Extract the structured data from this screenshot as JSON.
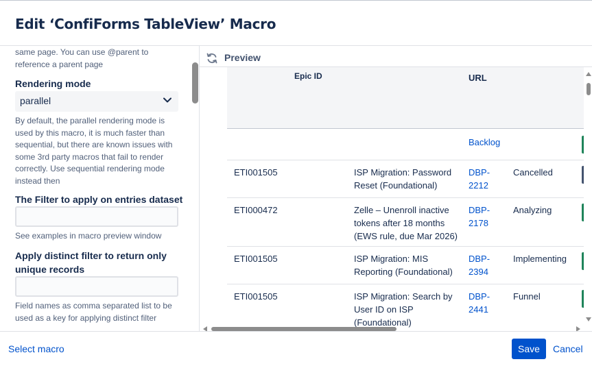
{
  "dialog": {
    "title": "Edit ‘ConfiForms TableView’ Macro"
  },
  "settings": {
    "parent_help": [
      "same page. You can use @parent to",
      "reference a parent page"
    ],
    "rendering_mode": {
      "label": "Rendering mode",
      "value": "parallel",
      "help": [
        "By default, the parallel rendering mode is",
        "used by this macro, it is much faster than",
        "sequential, but there are known issues with",
        "some 3rd party macros that fail to render",
        "correctly. Use sequential rendering mode",
        "instead then"
      ]
    },
    "filter": {
      "label": "The Filter to apply on entries dataset",
      "value": "",
      "help": "See examples in macro preview window"
    },
    "distinct": {
      "label": [
        "Apply distinct filter to return only",
        "unique records"
      ],
      "value": "",
      "help": [
        "Field names as comma separated list to be",
        "used as a key for applying distinct filter"
      ]
    }
  },
  "preview": {
    "label": "Preview",
    "refresh_icon": "refresh-icon",
    "columns": {
      "epic_id": "Epic ID",
      "url": "URL"
    },
    "rows": [
      {
        "id": "",
        "name": [],
        "url": [
          "Backlog"
        ],
        "status": "",
        "bar_color": "#1f845a"
      },
      {
        "id": "ETI001505",
        "name": [
          "ISP Migration: Password",
          "Reset (Foundational)"
        ],
        "url": [
          "DBP-",
          "2212"
        ],
        "status": "Cancelled",
        "bar_color": "#44546f"
      },
      {
        "id": "ETI000472",
        "name": [
          "Zelle – Unenroll inactive",
          "tokens after 18 months",
          "(EWS rule, due Mar 2026)"
        ],
        "url": [
          "DBP-",
          "2178"
        ],
        "status": "Analyzing",
        "bar_color": "#1f845a"
      },
      {
        "id": "ETI001505",
        "name": [
          "ISP Migration: MIS",
          "Reporting (Foundational)"
        ],
        "url": [
          "DBP-",
          "2394"
        ],
        "status": "Implementing",
        "bar_color": "#1f845a"
      },
      {
        "id": "ETI001505",
        "name": [
          "ISP Migration: Search by",
          "User ID on ISP",
          "(Foundational)"
        ],
        "url": [
          "DBP-",
          "2441"
        ],
        "status": "Funnel",
        "bar_color": "#1f845a"
      }
    ]
  },
  "footer": {
    "select_macro": "Select macro",
    "save": "Save",
    "cancel": "Cancel"
  }
}
